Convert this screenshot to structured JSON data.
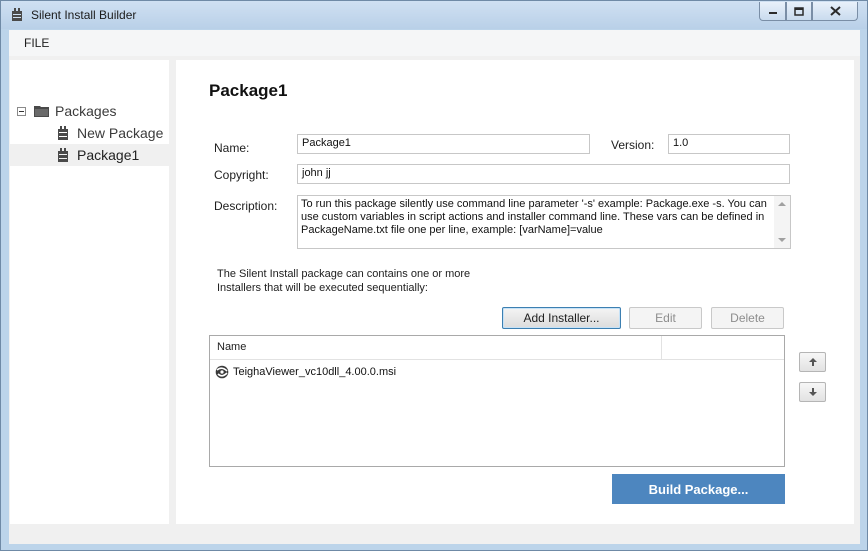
{
  "window": {
    "title": "Silent Install Builder",
    "controls": {
      "minimize": "minimize-icon",
      "maximize": "maximize-icon",
      "close": "close-icon"
    }
  },
  "menu": {
    "file_label": "FILE"
  },
  "tree": {
    "root_label": "Packages",
    "items": [
      {
        "label": "New Package",
        "selected": false
      },
      {
        "label": "Package1",
        "selected": true
      }
    ]
  },
  "form": {
    "heading": "Package1",
    "name_label": "Name:",
    "name_value": "Package1",
    "version_label": "Version:",
    "version_value": "1.0",
    "copyright_label": "Copyright:",
    "copyright_value": "john jj",
    "description_label": "Description:",
    "description_value": "To run this package silently use command line parameter '-s' example: Package.exe -s. You can use custom variables in script actions and installer command line. These vars can be defined in PackageName.txt file one per line, example: [varName]=value"
  },
  "installers": {
    "info_text": "The Silent Install package can contains one or more Installers that will be executed sequentially:",
    "add_label": "Add Installer...",
    "edit_label": "Edit",
    "delete_label": "Delete",
    "column_name": "Name",
    "rows": [
      {
        "name": "TeighaViewer_vc10dll_4.00.0.msi"
      }
    ]
  },
  "build_label": "Build Package...",
  "colors": {
    "accent": "#4d86bf",
    "titlebar": "#bcd4ea"
  }
}
